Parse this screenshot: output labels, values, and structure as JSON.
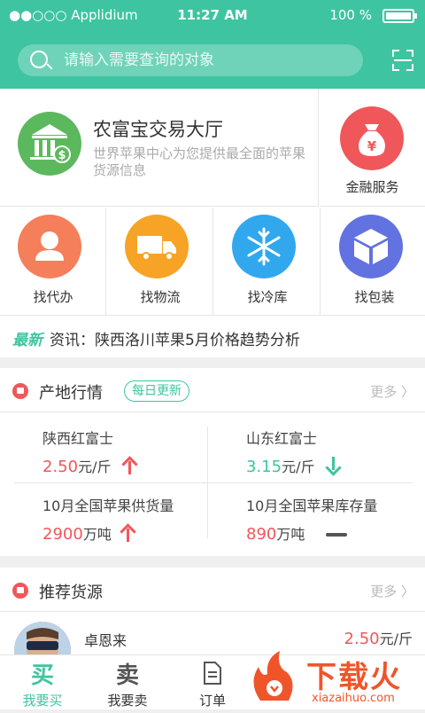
{
  "status": {
    "carrier": "●●○○○ Applidium",
    "time": "11:27 AM",
    "battery": "100 %"
  },
  "search": {
    "placeholder": "请输入需要查询的对象"
  },
  "hall": {
    "title": "农富宝交易大厅",
    "desc": "世界苹果中心为您提供最全面的苹果货源信息"
  },
  "finance": {
    "label": "金融服务"
  },
  "services": [
    {
      "label": "找代办",
      "icon": "person-icon",
      "color": "#f47f5a"
    },
    {
      "label": "找物流",
      "icon": "truck-icon",
      "color": "#f7a325"
    },
    {
      "label": "找冷库",
      "icon": "snowflake-icon",
      "color": "#31a8ee"
    },
    {
      "label": "找包装",
      "icon": "box-icon",
      "color": "#6272e0"
    }
  ],
  "news": {
    "tag": "最新",
    "text": "资讯：陕西洛川苹果5月价格趋势分析"
  },
  "market": {
    "title": "产地行情",
    "badge": "每日更新",
    "more": "更多 〉",
    "items": [
      {
        "name": "陕西红富士",
        "value": "2.50",
        "unit": "元/斤",
        "trend": "up"
      },
      {
        "name": "山东红富士",
        "value": "3.15",
        "unit": "元/斤",
        "trend": "down"
      },
      {
        "name": "10月全国苹果供货量",
        "value": "2900",
        "unit": "万吨",
        "trend": "up"
      },
      {
        "name": "10月全国苹果库存量",
        "value": "890",
        "unit": "万吨",
        "trend": "flat"
      }
    ]
  },
  "recommend": {
    "title": "推荐货源",
    "more": "更多 〉",
    "seller": "卓恩来",
    "price": "2.50",
    "price_unit": "元/斤"
  },
  "tabs": [
    {
      "glyph": "买",
      "label": "我要买",
      "active": true
    },
    {
      "glyph": "卖",
      "label": "我要卖",
      "active": false
    },
    {
      "glyph": "",
      "label": "订单",
      "active": false
    }
  ],
  "watermark": {
    "brand": "下载火",
    "url": "xiazaihuo.com"
  },
  "colors": {
    "primary": "#3ec4a0",
    "red": "#f0575a",
    "text": "#333333"
  }
}
